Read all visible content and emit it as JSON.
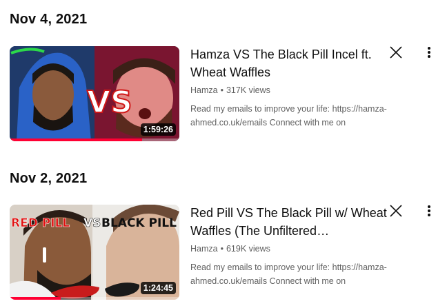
{
  "history": [
    {
      "date": "Nov 4, 2021",
      "video": {
        "title": "Hamza VS The Black Pill Incel ft. Wheat Waffles",
        "channel": "Hamza",
        "views": "317K views",
        "description": "Read my emails to improve your life: https://hamza-ahmed.co.uk/emails Connect with me on Instagram:…",
        "duration": "1:59:26",
        "watched_fraction": 0.78,
        "thumb_text": "VS"
      }
    },
    {
      "date": "Nov 2, 2021",
      "video": {
        "title": "Red Pill VS The Black Pill w/ Wheat Waffles (The Unfiltered…",
        "channel": "Hamza",
        "views": "619K views",
        "description": "Read my emails to improve your life: https://hamza-ahmed.co.uk/emails Connect with me on Instagram:…",
        "duration": "1:24:45",
        "watched_fraction": 0.3,
        "thumb_text_red": "RED PILL",
        "thumb_text_vs": "VS",
        "thumb_text_black": "BLACK PILL"
      }
    }
  ],
  "icons": {
    "remove": "close-icon",
    "menu": "more-vert-icon"
  },
  "colors": {
    "progress": "#ff0033",
    "meta_text": "#606060"
  }
}
